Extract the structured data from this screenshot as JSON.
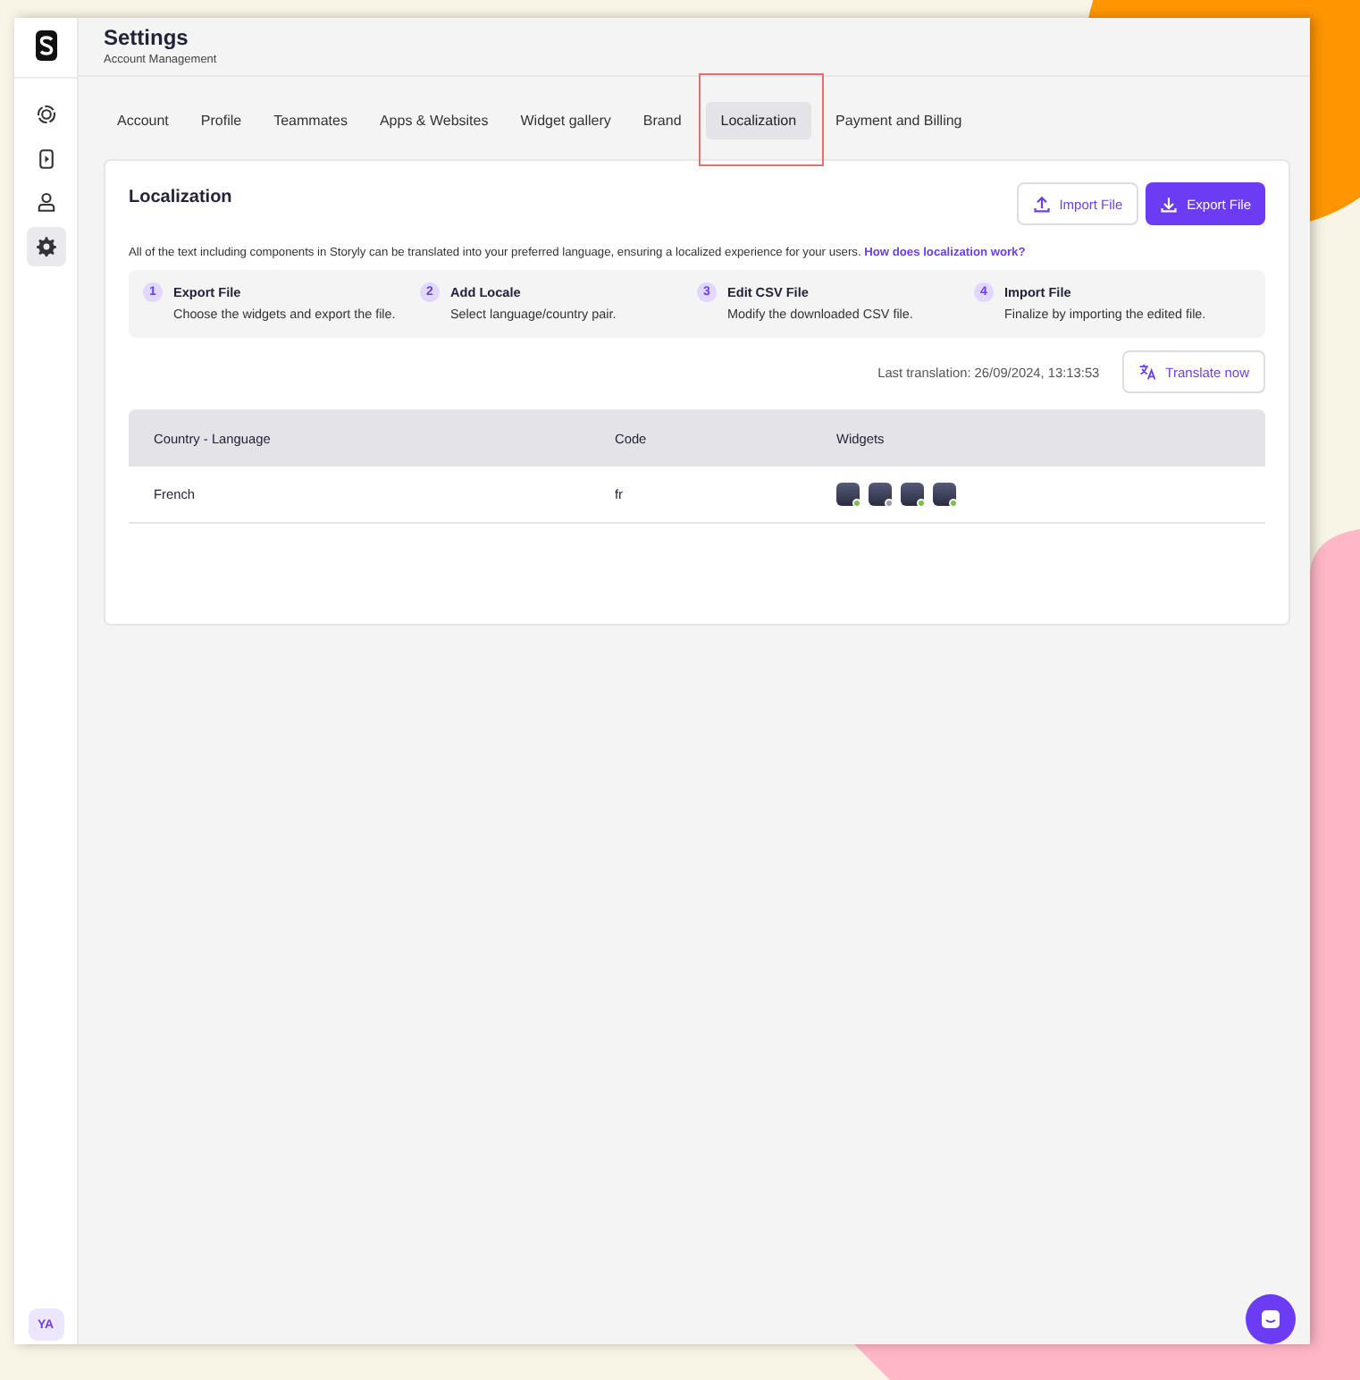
{
  "sidebar": {
    "items": [
      {
        "kind": "target",
        "selected": false
      },
      {
        "kind": "play",
        "selected": false
      },
      {
        "kind": "user",
        "selected": false
      },
      {
        "kind": "gear",
        "selected": true
      }
    ],
    "avatar": "YA"
  },
  "header": {
    "title": "Settings",
    "subtitle": "Account Management"
  },
  "tabs": [
    {
      "label": "Account",
      "selected": false,
      "highlighted": false
    },
    {
      "label": "Profile",
      "selected": false,
      "highlighted": false
    },
    {
      "label": "Teammates",
      "selected": false,
      "highlighted": false
    },
    {
      "label": "Apps & Websites",
      "selected": false,
      "highlighted": false
    },
    {
      "label": "Widget gallery",
      "selected": false,
      "highlighted": false
    },
    {
      "label": "Brand",
      "selected": false,
      "highlighted": false
    },
    {
      "label": "Localization",
      "selected": true,
      "highlighted": true
    },
    {
      "label": "Payment and Billing",
      "selected": false,
      "highlighted": false
    }
  ],
  "card": {
    "title": "Localization",
    "buttons": [
      {
        "kind": "import",
        "label": "Import File"
      },
      {
        "kind": "export",
        "label": "Export File"
      }
    ],
    "description": "All of the text including components in Storyly can be translated into your preferred language, ensuring a localized experience for your users.",
    "link": "How does localization work?",
    "steps": [
      {
        "number": "1",
        "title": "Export File",
        "text": "Choose the widgets and export the file."
      },
      {
        "number": "2",
        "title": "Add Locale",
        "text": "Select language/country pair."
      },
      {
        "number": "3",
        "title": "Edit CSV File",
        "text": "Modify the downloaded CSV file."
      },
      {
        "number": "4",
        "title": "Import File",
        "text": "Finalize by importing the edited file."
      }
    ],
    "last_translation": "Last translation: 26/09/2024, 13:13:53",
    "translate_button": "Translate now",
    "table": {
      "columns": [
        "Country - Language",
        "Code",
        "Widgets"
      ],
      "rows": [
        {
          "language": "French",
          "code": "fr",
          "widgets": [
            {
              "color": "#7cc242"
            },
            {
              "color": "#9e9e9e"
            },
            {
              "color": "#7cc242"
            },
            {
              "color": "#7cc242"
            }
          ]
        }
      ]
    }
  }
}
